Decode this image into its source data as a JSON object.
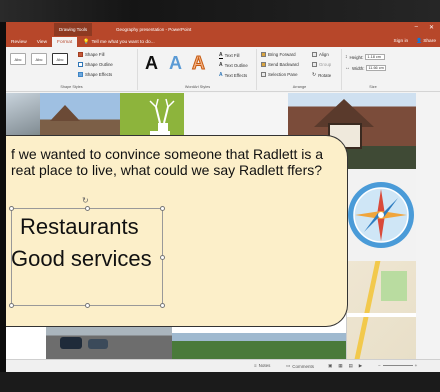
{
  "window": {
    "context_tab": "Drawing Tools",
    "document_title": "Geography presentation - PowerPoint"
  },
  "tabs": [
    "Review",
    "View",
    "Format"
  ],
  "active_tab": "Format",
  "tell_me": "Tell me what you want to do...",
  "account": {
    "sign_in": "Sign in",
    "share": "Share"
  },
  "ribbon": {
    "shape_styles": {
      "label": "Shape Styles",
      "samples": [
        "Abc",
        "Abc",
        "Abc"
      ],
      "fill": "Shape Fill",
      "outline": "Shape Outline",
      "effects": "Shape Effects"
    },
    "wordart": {
      "label": "WordArt Styles",
      "text_fill": "Text Fill",
      "text_outline": "Text Outline",
      "text_effects": "Text Effects"
    },
    "arrange": {
      "label": "Arrange",
      "bring_forward": "Bring Forward",
      "send_backward": "Send Backward",
      "selection_pane": "Selection Pane",
      "align": "Align",
      "group": "Group",
      "rotate": "Rotate"
    },
    "size": {
      "label": "Size",
      "height_label": "Height:",
      "height_value": "1.18 cm",
      "width_label": "Width:",
      "width_value": "11.66 cm"
    }
  },
  "slide": {
    "question": "f we wanted to convince someone that Radlett is a reat place to live, what could we say Radlett ffers?",
    "answers": [
      "Restaurants",
      "Good services"
    ]
  },
  "status": {
    "notes": "Notes",
    "comments": "Comments"
  },
  "colors": {
    "accent": "#b7472a",
    "callout": "#fcefc9",
    "ribbon": "#f3f3f3"
  }
}
